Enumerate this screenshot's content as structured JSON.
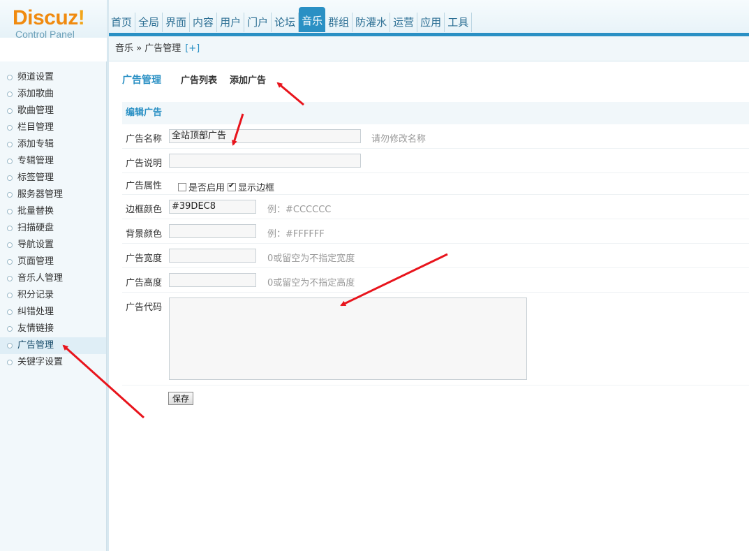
{
  "logo": {
    "brand": "Discuz",
    "bang": "!",
    "sub": "Control Panel"
  },
  "topnav": [
    "首页",
    "全局",
    "界面",
    "内容",
    "用户",
    "门户",
    "论坛",
    "音乐",
    "群组",
    "防灌水",
    "运营",
    "应用",
    "工具"
  ],
  "topnav_active": "音乐",
  "breadcrumb": {
    "text": "音乐 » 广告管理",
    "add": "[+]"
  },
  "sidebar": {
    "items": [
      "频道设置",
      "添加歌曲",
      "歌曲管理",
      "栏目管理",
      "添加专辑",
      "专辑管理",
      "标签管理",
      "服务器管理",
      "批量替换",
      "扫描硬盘",
      "导航设置",
      "页面管理",
      "音乐人管理",
      "积分记录",
      "纠错处理",
      "友情链接",
      "广告管理",
      "关键字设置"
    ],
    "active": "广告管理"
  },
  "main": {
    "title": "广告管理",
    "tabs": [
      "广告列表",
      "添加广告"
    ]
  },
  "form": {
    "section": "编辑广告",
    "name_label": "广告名称",
    "name_value": "全站顶部广告",
    "name_hint": "请勿修改名称",
    "desc_label": "广告说明",
    "desc_value": "",
    "attr_label": "广告属性",
    "attr_enable": "是否启用",
    "attr_enable_checked": false,
    "attr_border": "显示边框",
    "attr_border_checked": true,
    "border_color_label": "边框颜色",
    "border_color_value": "#39DEC8",
    "border_color_hint": "例：#CCCCCC",
    "bg_color_label": "背景颜色",
    "bg_color_value": "",
    "bg_color_hint": "例：#FFFFFF",
    "width_label": "广告宽度",
    "width_value": "",
    "width_hint": "0或留空为不指定宽度",
    "height_label": "广告高度",
    "height_value": "",
    "height_hint": "0或留空为不指定高度",
    "code_label": "广告代码",
    "code_value": "",
    "save": "保存"
  },
  "colors": {
    "accent": "#2a90c4",
    "logo": "#f08a0f",
    "arrow": "#e8141c"
  }
}
